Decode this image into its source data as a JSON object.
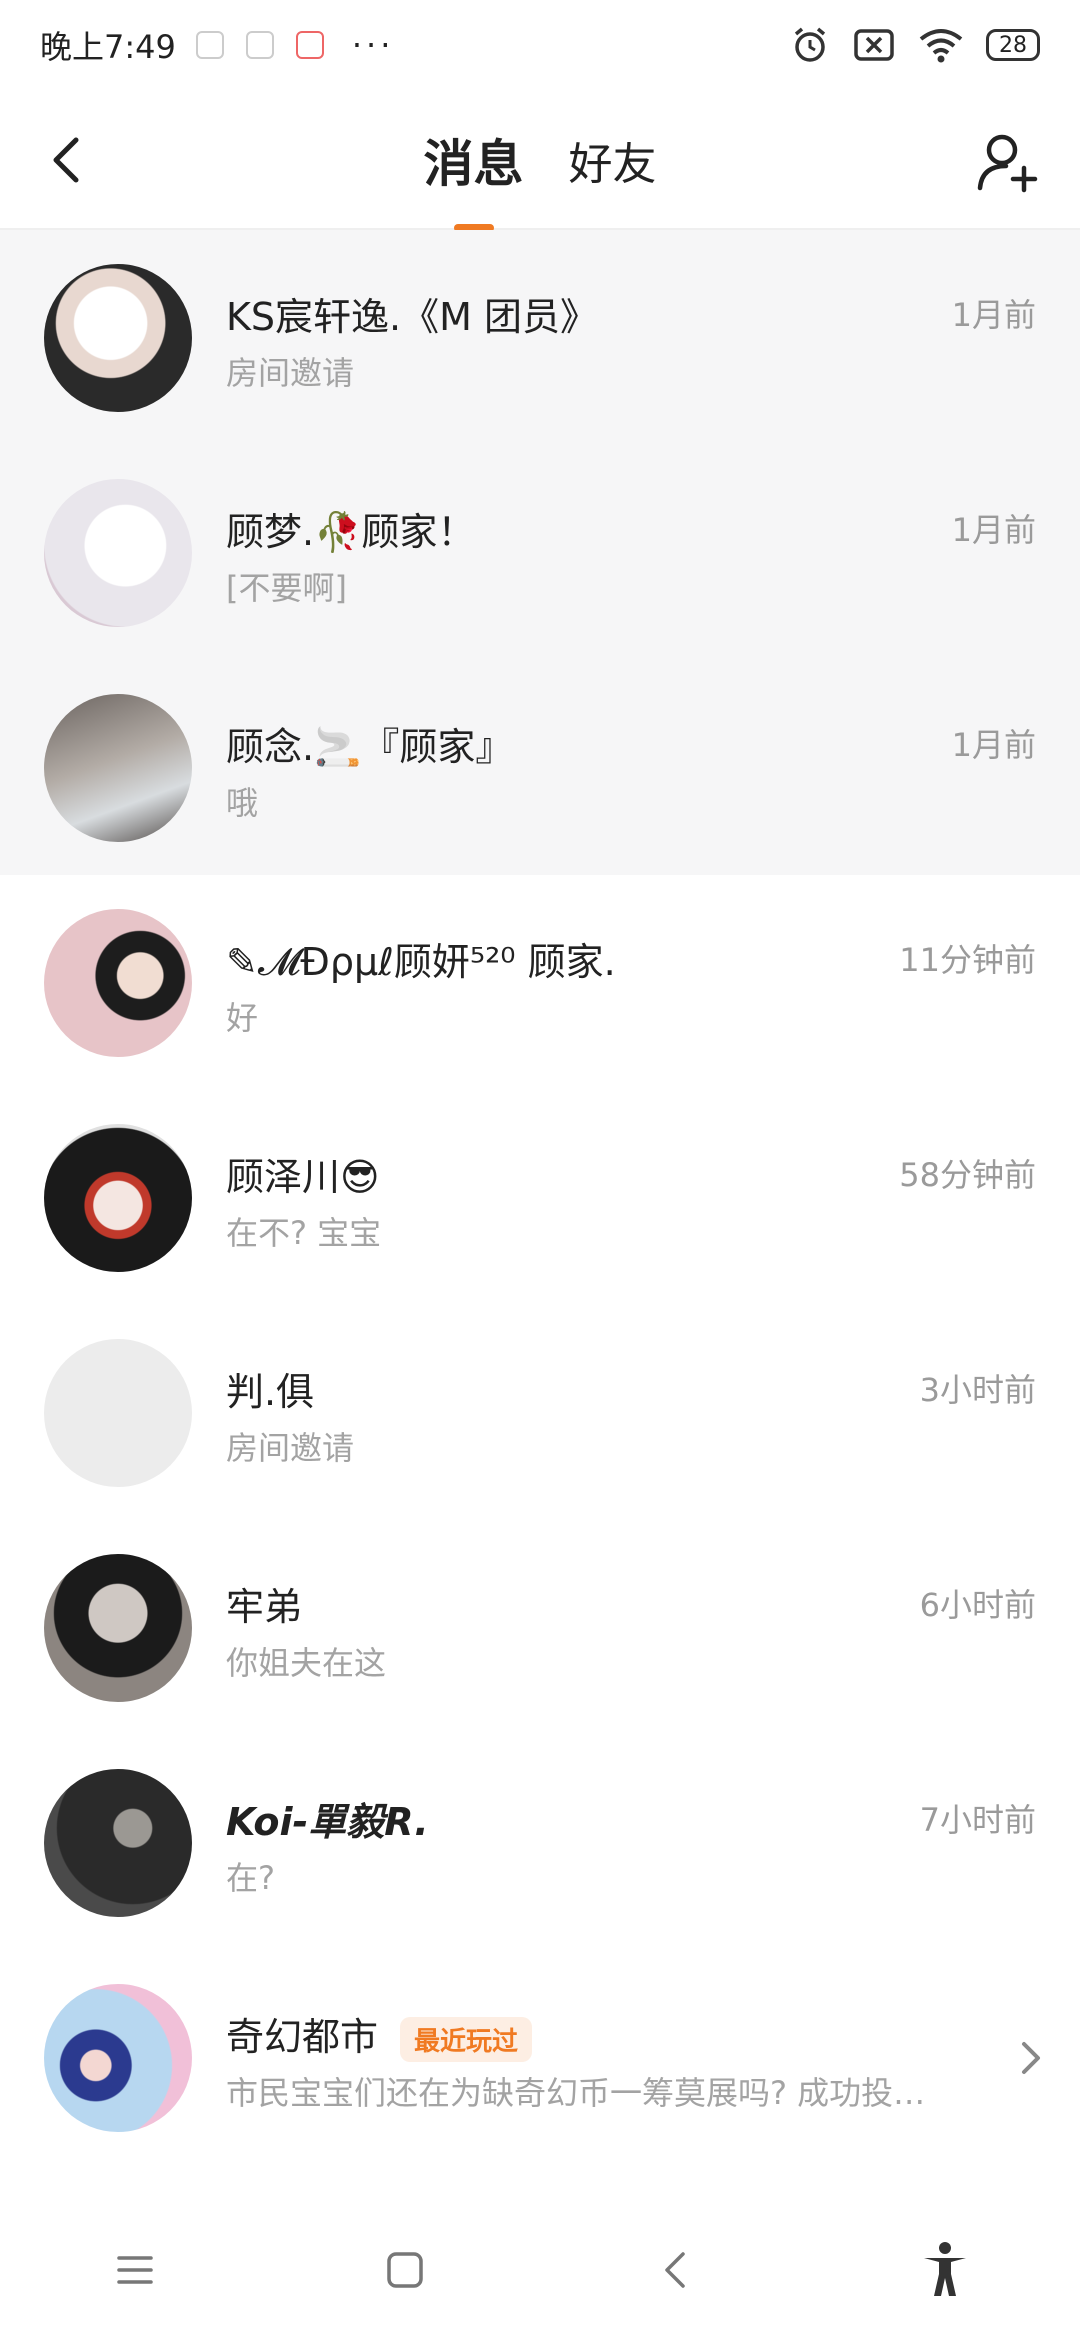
{
  "status_bar": {
    "time": "晚上7:49",
    "dots": "···",
    "battery": "28",
    "icons": [
      "alarm-icon",
      "sim-disabled-icon",
      "wifi-icon",
      "battery-icon"
    ]
  },
  "header": {
    "tabs": [
      {
        "label": "消息",
        "active": true
      },
      {
        "label": "好友",
        "active": false
      }
    ],
    "accent_color": "#f07a22"
  },
  "conversations": [
    {
      "name": "KS宸轩逸.《M 团员》",
      "preview": "房间邀请",
      "time": "1月前",
      "pinned": true
    },
    {
      "name": "顾梦.🥀顾家！",
      "preview": "[不要啊]",
      "time": "1月前",
      "pinned": true
    },
    {
      "name": "顾念.🚬『顾家』",
      "preview": "哦",
      "time": "1月前",
      "pinned": true
    },
    {
      "name": "✎𝓜Ɖρµℓ顾妍⁵²⁰ 顾家.",
      "preview": "好",
      "time": "11分钟前",
      "pinned": false
    },
    {
      "name": "顾泽川😎",
      "preview": "在不? 宝宝",
      "time": "58分钟前",
      "pinned": false
    },
    {
      "name": "判.俱",
      "preview": "房间邀请",
      "time": "3小时前",
      "pinned": false
    },
    {
      "name": "牢弟",
      "preview": "你姐夫在这",
      "time": "6小时前",
      "pinned": false
    },
    {
      "name": "Koi-單毅R.",
      "preview": "在?",
      "time": "7小时前",
      "pinned": false
    }
  ],
  "promo": {
    "name": "奇幻都市",
    "badge": "最近玩过",
    "preview": "市民宝宝们还在为缺奇幻币一筹莫展吗? 成功投…"
  }
}
